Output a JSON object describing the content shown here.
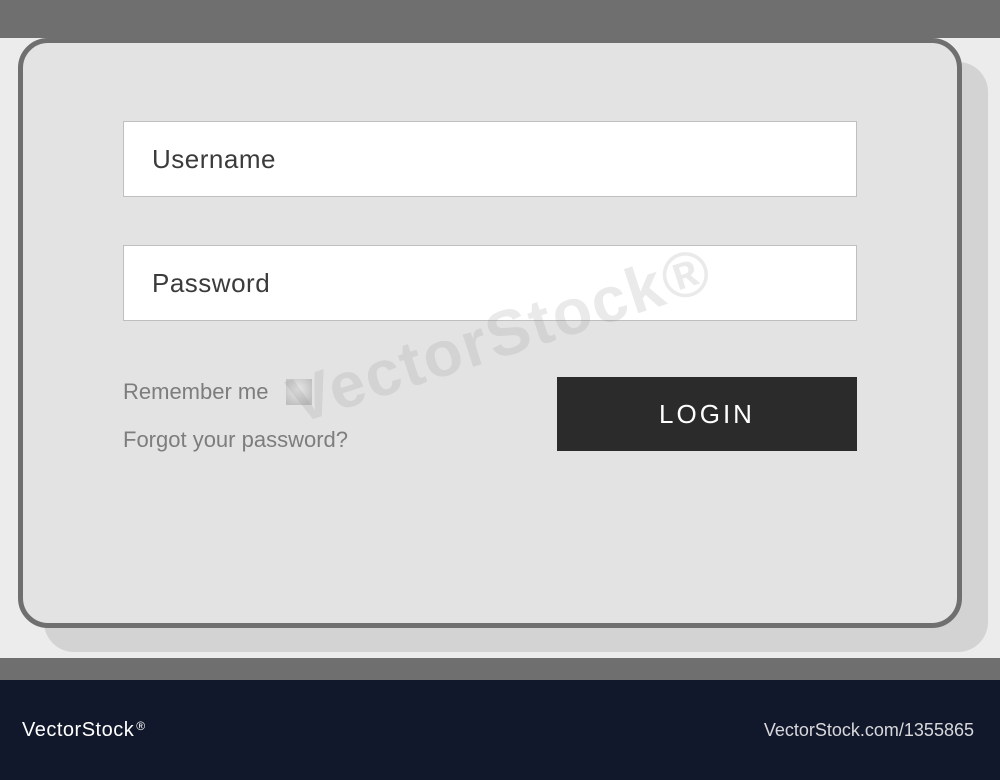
{
  "form": {
    "username_placeholder": "Username",
    "password_placeholder": "Password",
    "remember_label": "Remember me",
    "forgot_label": "Forgot your password?",
    "login_label": "LOGIN"
  },
  "footer": {
    "brand": "VectorStock",
    "reg": "®",
    "attribution": "VectorStock.com/1355865"
  },
  "watermark": "VectorStock®"
}
